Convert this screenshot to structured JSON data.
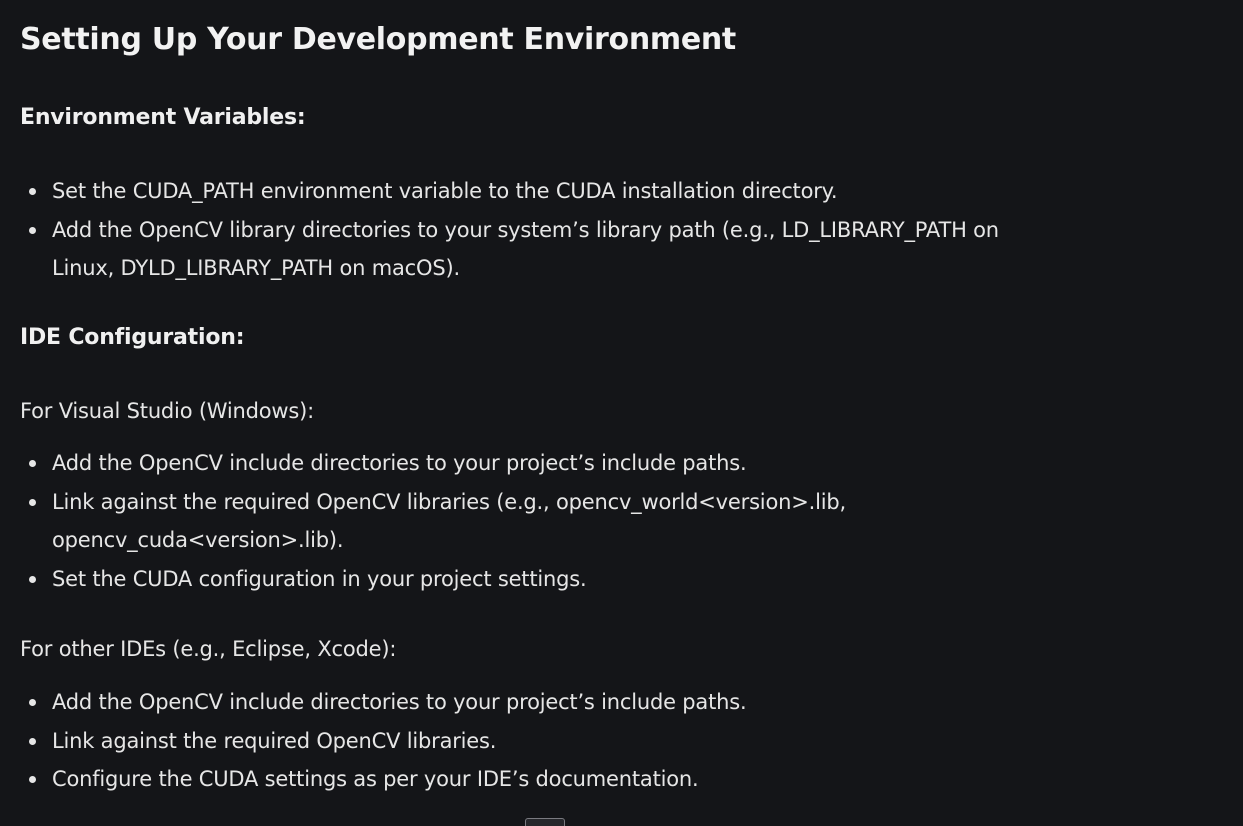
{
  "article": {
    "title": "Setting Up Your Development Environment",
    "env_vars": {
      "heading": "Environment Variables:",
      "items": [
        "Set the CUDA_PATH environment variable to the CUDA installation directory.",
        "Add the OpenCV library directories to your system’s library path (e.g., LD_LIBRARY_PATH on Linux, DYLD_LIBRARY_PATH on macOS)."
      ]
    },
    "ide": {
      "heading": "IDE Configuration:",
      "visual_studio": {
        "intro": "For Visual Studio (Windows):",
        "items": [
          "Add the OpenCV include directories to your project’s include paths.",
          "Link against the required OpenCV libraries (e.g., opencv_world<version>.lib, opencv_cuda<version>.lib).",
          "Set the CUDA configuration in your project settings."
        ]
      },
      "other": {
        "intro": "For other IDEs (e.g., Eclipse, Xcode):",
        "items": [
          "Add the OpenCV include directories to your project’s include paths.",
          "Link against the required OpenCV libraries.",
          "Configure the CUDA settings as per your IDE’s documentation."
        ]
      }
    }
  }
}
